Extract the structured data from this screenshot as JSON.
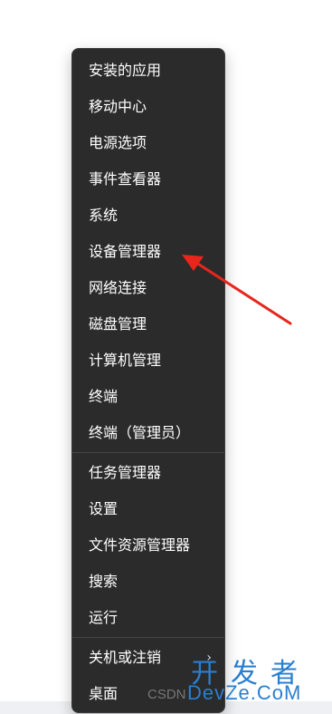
{
  "menu": {
    "group1": [
      {
        "label": "安装的应用"
      },
      {
        "label": "移动中心"
      },
      {
        "label": "电源选项"
      },
      {
        "label": "事件查看器"
      },
      {
        "label": "系统"
      },
      {
        "label": "设备管理器"
      },
      {
        "label": "网络连接"
      },
      {
        "label": "磁盘管理"
      },
      {
        "label": "计算机管理"
      },
      {
        "label": "终端"
      },
      {
        "label": "终端（管理员）"
      }
    ],
    "group2": [
      {
        "label": "任务管理器"
      },
      {
        "label": "设置"
      },
      {
        "label": "文件资源管理器"
      },
      {
        "label": "搜索"
      },
      {
        "label": "运行"
      }
    ],
    "group3": [
      {
        "label": "关机或注销",
        "submenu_arrow": "›"
      },
      {
        "label": "桌面"
      }
    ]
  },
  "annotation": {
    "color": "#e8261c",
    "points_to": "设备管理器"
  },
  "watermark": {
    "logo_top": "开发者",
    "logo_bottom": "DevZe.CoM",
    "csdn": "CSDN"
  },
  "colors": {
    "menu_bg": "#2b2b2b",
    "menu_text": "#ffffff",
    "separator": "#454545",
    "watermark": "#2a7fd0"
  }
}
